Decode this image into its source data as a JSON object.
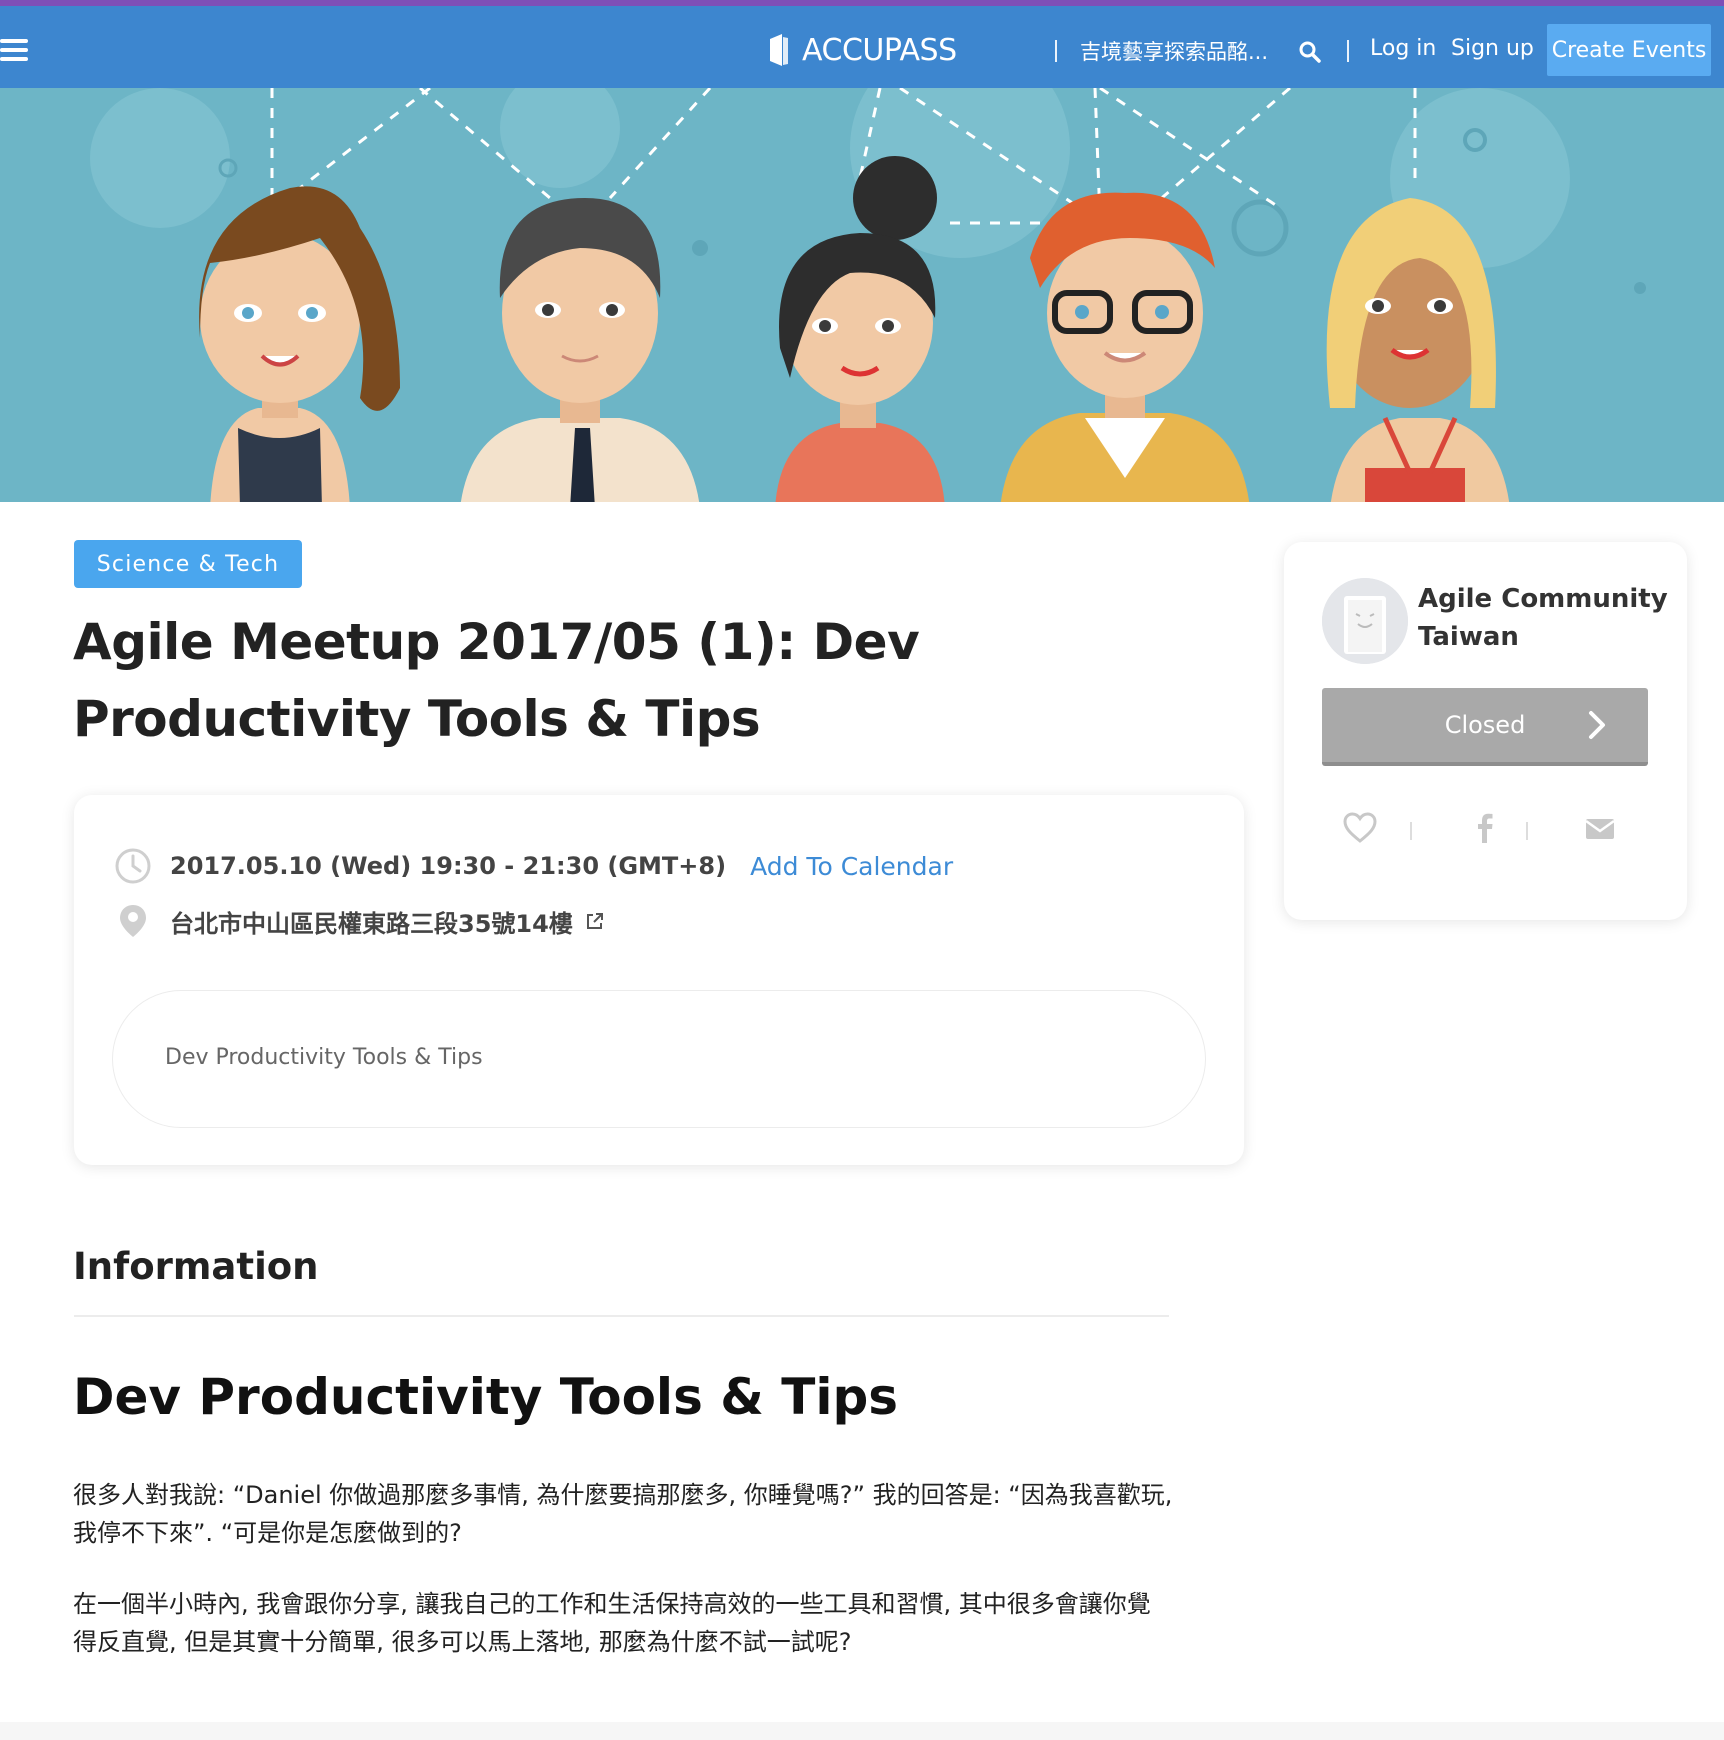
{
  "navbar": {
    "logo_text": "ACCUPASS",
    "search_text": "吉境藝享探索品酩...",
    "login_label": "Log in",
    "signup_label": "Sign up",
    "create_label": "Create Events"
  },
  "event": {
    "category": "Science & Tech",
    "title": "Agile Meetup 2017/05 (1): Dev Productivity Tools & Tips",
    "datetime": "2017.05.10 (Wed) 19:30 - 21:30 (GMT+8)",
    "add_calendar_label": "Add To Calendar",
    "address": "台北市中山區民權東路三段35號14樓",
    "summary": "Dev Productivity Tools & Tips"
  },
  "organizer": {
    "name": "Agile Community Taiwan",
    "status_button": "Closed"
  },
  "content": {
    "section_heading": "Information",
    "subheading": "Dev Productivity Tools & Tips",
    "paragraphs": [
      "很多人對我說: “Daniel 你做過那麼多事情, 為什麼要搞那麼多, 你睡覺嗎?” 我的回答是: “因為我喜歡玩, 我停不下來”. “可是你是怎麼做到的?",
      "在一個半小時內, 我會跟你分享, 讓我自己的工作和生活保持高效的一些工具和習慣, 其中很多會讓你覺得反直覺, 但是其實十分簡單, 很多可以馬上落地, 那麼為什麼不試一試呢?"
    ]
  },
  "colors": {
    "navbar": "#3d86cf",
    "top_strip": "#7e4fb7",
    "accent": "#4aa6ee",
    "closed_button": "#a9a9a9",
    "hero_bg": "#6db5c6"
  },
  "icons": [
    "menu-icon",
    "accupass-logo-icon",
    "search-icon",
    "clock-icon",
    "map-pin-icon",
    "external-link-icon",
    "chevron-right-icon",
    "heart-icon",
    "facebook-icon",
    "mail-icon"
  ]
}
